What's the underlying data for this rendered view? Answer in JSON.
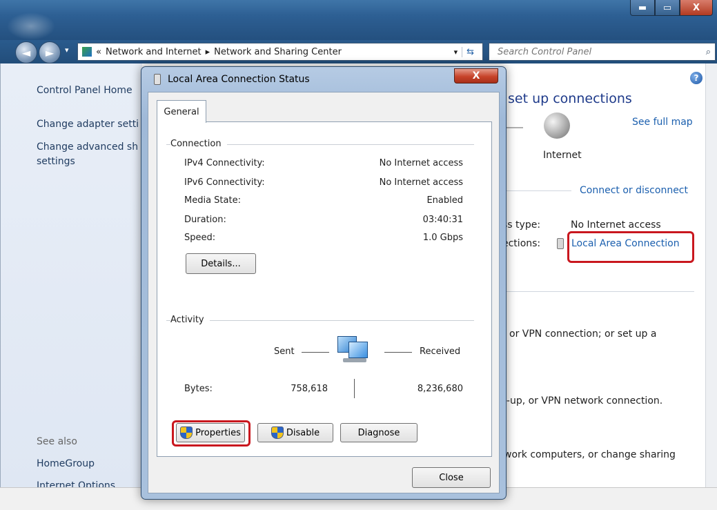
{
  "window": {
    "min_glyph": "▬",
    "max_glyph": "▭",
    "close_glyph": "X"
  },
  "nav": {
    "back_glyph": "◄",
    "forward_glyph": "►",
    "breadcrumb_prefix": "«",
    "breadcrumb": [
      "Network and Internet",
      "Network and Sharing Center"
    ],
    "separator": "▸",
    "dropdown_glyph": "▾",
    "refresh_glyph": "⇆",
    "search_placeholder": "Search Control Panel",
    "search_glyph": "⌕"
  },
  "left_pane": {
    "items": [
      "Control Panel Home",
      "Change adapter setti",
      "Change advanced sh",
      "settings"
    ],
    "see_also_label": "See also",
    "see_also": [
      "HomeGroup",
      "Internet Options"
    ]
  },
  "main": {
    "heading": "set up connections",
    "see_full_map": "See full map",
    "internet_label": "Internet",
    "connect_or_disconnect": "Connect or disconnect",
    "access_type_label": "ss type:",
    "access_type_value": "No Internet access",
    "connections_label": "ections:",
    "connection_link": "Local Area Connection",
    "task1": "or VPN connection; or set up a",
    "task2": "l-up, or VPN network connection.",
    "task3": "work computers, or change sharing",
    "help_glyph": "?"
  },
  "dialog": {
    "title": "Local Area Connection Status",
    "close_glyph": "X",
    "tab": "General",
    "connection_group": "Connection",
    "rows": [
      {
        "label": "IPv4 Connectivity:",
        "value": "No Internet access"
      },
      {
        "label": "IPv6 Connectivity:",
        "value": "No Internet access"
      },
      {
        "label": "Media State:",
        "value": "Enabled"
      },
      {
        "label": "Duration:",
        "value": "03:40:31"
      },
      {
        "label": "Speed:",
        "value": "1.0 Gbps"
      }
    ],
    "details_button": "Details...",
    "activity_group": "Activity",
    "sent_label": "Sent",
    "received_label": "Received",
    "bytes_label": "Bytes:",
    "bytes_sent": "758,618",
    "bytes_received": "8,236,680",
    "properties_button": "Properties",
    "disable_button": "Disable",
    "diagnose_button": "Diagnose",
    "close_button": "Close"
  },
  "colors": {
    "highlight_box": "#c9171e",
    "link": "#1b5fae"
  }
}
